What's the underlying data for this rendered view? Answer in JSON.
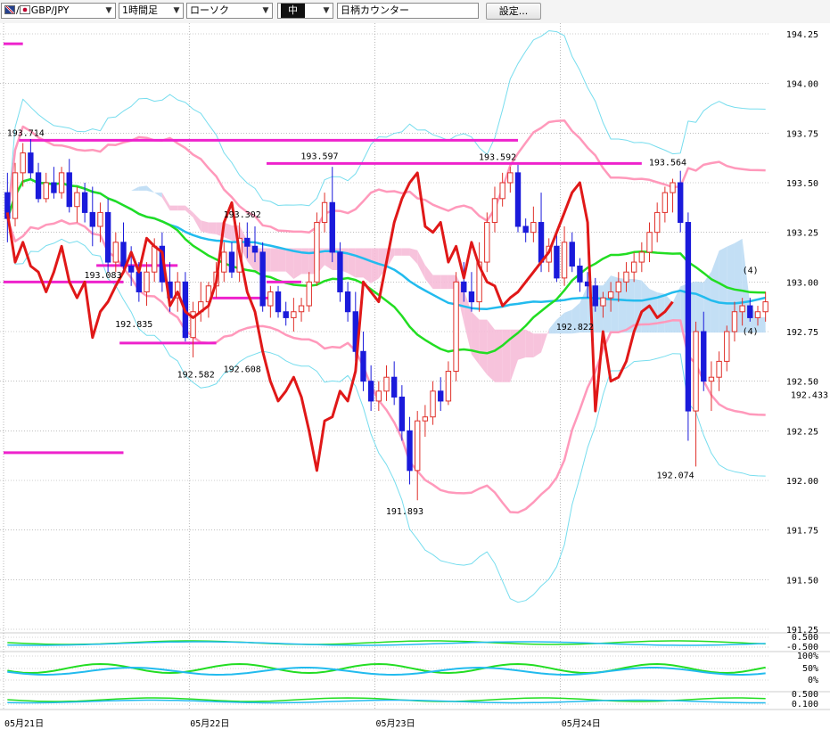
{
  "toolbar": {
    "symbol": "GBP/JPY",
    "timeframe": "1時間足",
    "chart_style": "ローソク",
    "size": "中",
    "counter": "日柄カウンター",
    "settings": "設定..."
  },
  "colors": {
    "up_candle": "#e0302a",
    "down_candle": "#1a1adb",
    "sma_short": "#22dd22",
    "sma_long": "#22bbee",
    "bb_2sigma": "#ff99bb",
    "bb_3sigma": "#77ddee",
    "red_line": "#e01818",
    "level_lines": "#ee22cc",
    "kumo_bear": "#f6bcd8",
    "kumo_bull": "#bcdcf4"
  },
  "chart_data": {
    "type": "candlestick",
    "pair": "GBP/JPY",
    "y_axis": {
      "min": 191.25,
      "max": 194.25,
      "ticks": [
        "194.25",
        "194.00",
        "193.75",
        "193.50",
        "193.25",
        "193.00",
        "192.75",
        "192.50",
        "192.25",
        "192.00",
        "191.75",
        "191.50",
        "191.25"
      ]
    },
    "current_price": "192.433",
    "x_labels": [
      "05月21日",
      "05月22日",
      "05月23日",
      "05月24日"
    ],
    "annotations": [
      {
        "text": "193.714",
        "price": 193.714
      },
      {
        "text": "193.083",
        "price": 193.083
      },
      {
        "text": "192.835",
        "price": 192.835
      },
      {
        "text": "192.582",
        "price": 192.582
      },
      {
        "text": "193.302",
        "price": 193.302
      },
      {
        "text": "192.608",
        "price": 192.608
      },
      {
        "text": "193.597",
        "price": 193.597
      },
      {
        "text": "191.893",
        "price": 191.893
      },
      {
        "text": "193.592",
        "price": 193.592
      },
      {
        "text": "192.822",
        "price": 192.822
      },
      {
        "text": "193.564",
        "price": 193.564
      },
      {
        "text": "192.074",
        "price": 192.074
      },
      {
        "text": "(4)",
        "price": 193.0
      },
      {
        "text": "(4)",
        "price": 192.8
      }
    ],
    "candles": [
      [
        193.45,
        193.55,
        193.2,
        193.32
      ],
      [
        193.32,
        193.6,
        193.28,
        193.55
      ],
      [
        193.55,
        193.7,
        193.48,
        193.65
      ],
      [
        193.65,
        193.72,
        193.52,
        193.55
      ],
      [
        193.55,
        193.6,
        193.4,
        193.42
      ],
      [
        193.42,
        193.55,
        193.4,
        193.5
      ],
      [
        193.5,
        193.58,
        193.42,
        193.45
      ],
      [
        193.45,
        193.58,
        193.42,
        193.55
      ],
      [
        193.55,
        193.62,
        193.35,
        193.38
      ],
      [
        193.38,
        193.48,
        193.3,
        193.45
      ],
      [
        193.45,
        193.5,
        193.3,
        193.35
      ],
      [
        193.35,
        193.48,
        193.18,
        193.28
      ],
      [
        193.28,
        193.4,
        193.2,
        193.35
      ],
      [
        193.35,
        193.42,
        193.05,
        193.1
      ],
      [
        193.1,
        193.25,
        193.05,
        193.2
      ],
      [
        193.2,
        193.3,
        193.05,
        193.08
      ],
      [
        193.08,
        193.18,
        192.98,
        193.05
      ],
      [
        193.05,
        193.1,
        192.9,
        192.95
      ],
      [
        192.95,
        193.1,
        192.88,
        193.05
      ],
      [
        193.05,
        193.22,
        193.0,
        193.18
      ],
      [
        193.18,
        193.25,
        192.95,
        193.0
      ],
      [
        193.0,
        193.1,
        192.85,
        192.92
      ],
      [
        192.92,
        193.05,
        192.85,
        193.0
      ],
      [
        193.0,
        193.05,
        192.7,
        192.72
      ],
      [
        192.72,
        192.9,
        192.62,
        192.85
      ],
      [
        192.85,
        193.0,
        192.8,
        192.9
      ],
      [
        192.9,
        193.0,
        192.82,
        192.98
      ],
      [
        192.98,
        193.1,
        192.92,
        193.05
      ],
      [
        193.05,
        193.2,
        193.0,
        193.15
      ],
      [
        193.15,
        193.2,
        193.02,
        193.05
      ],
      [
        193.05,
        193.3,
        193.0,
        193.22
      ],
      [
        193.22,
        193.3,
        193.12,
        193.18
      ],
      [
        193.18,
        193.28,
        193.1,
        193.15
      ],
      [
        193.15,
        193.2,
        192.85,
        192.88
      ],
      [
        192.88,
        192.98,
        192.82,
        192.95
      ],
      [
        192.95,
        192.98,
        192.82,
        192.85
      ],
      [
        192.85,
        192.9,
        192.78,
        192.82
      ],
      [
        192.82,
        192.92,
        192.75,
        192.85
      ],
      [
        192.85,
        192.92,
        192.8,
        192.88
      ],
      [
        192.88,
        193.05,
        192.85,
        193.0
      ],
      [
        193.0,
        193.35,
        192.98,
        193.3
      ],
      [
        193.3,
        193.45,
        193.25,
        193.4
      ],
      [
        193.4,
        193.58,
        193.1,
        193.15
      ],
      [
        193.15,
        193.2,
        192.9,
        192.95
      ],
      [
        192.95,
        193.0,
        192.8,
        192.85
      ],
      [
        192.85,
        192.95,
        192.6,
        192.65
      ],
      [
        192.65,
        192.75,
        192.45,
        192.5
      ],
      [
        192.5,
        192.58,
        192.35,
        192.4
      ],
      [
        192.4,
        192.5,
        192.35,
        192.45
      ],
      [
        192.45,
        192.58,
        192.4,
        192.52
      ],
      [
        192.52,
        192.6,
        192.38,
        192.42
      ],
      [
        192.42,
        192.48,
        192.2,
        192.25
      ],
      [
        192.25,
        192.32,
        191.98,
        192.05
      ],
      [
        192.05,
        192.35,
        191.9,
        192.3
      ],
      [
        192.3,
        192.38,
        192.22,
        192.32
      ],
      [
        192.32,
        192.5,
        192.28,
        192.45
      ],
      [
        192.45,
        192.52,
        192.35,
        192.4
      ],
      [
        192.4,
        192.6,
        192.38,
        192.55
      ],
      [
        192.55,
        193.05,
        192.5,
        193.0
      ],
      [
        193.0,
        193.1,
        192.9,
        192.95
      ],
      [
        192.95,
        193.05,
        192.85,
        192.9
      ],
      [
        192.9,
        193.2,
        192.85,
        193.1
      ],
      [
        193.1,
        193.35,
        193.05,
        193.3
      ],
      [
        193.3,
        193.48,
        193.25,
        193.42
      ],
      [
        193.42,
        193.55,
        193.38,
        193.5
      ],
      [
        193.5,
        193.58,
        193.45,
        193.55
      ],
      [
        193.55,
        193.59,
        193.25,
        193.28
      ],
      [
        193.28,
        193.32,
        193.2,
        193.25
      ],
      [
        193.25,
        193.38,
        193.2,
        193.3
      ],
      [
        193.3,
        193.45,
        193.05,
        193.1
      ],
      [
        193.1,
        193.22,
        193.05,
        193.18
      ],
      [
        193.18,
        193.25,
        193.0,
        193.02
      ],
      [
        193.02,
        193.28,
        192.98,
        193.2
      ],
      [
        193.2,
        193.25,
        193.05,
        193.08
      ],
      [
        193.08,
        193.12,
        192.95,
        193.0
      ],
      [
        193.0,
        193.05,
        192.92,
        192.98
      ],
      [
        192.98,
        193.02,
        192.85,
        192.88
      ],
      [
        192.88,
        192.95,
        192.82,
        192.92
      ],
      [
        192.92,
        193.0,
        192.85,
        192.95
      ],
      [
        192.95,
        193.05,
        192.9,
        193.0
      ],
      [
        193.0,
        193.1,
        192.95,
        193.05
      ],
      [
        193.05,
        193.15,
        193.0,
        193.1
      ],
      [
        193.1,
        193.2,
        193.05,
        193.15
      ],
      [
        193.15,
        193.3,
        193.1,
        193.25
      ],
      [
        193.25,
        193.4,
        193.2,
        193.35
      ],
      [
        193.35,
        193.48,
        193.3,
        193.45
      ],
      [
        193.45,
        193.52,
        193.35,
        193.5
      ],
      [
        193.5,
        193.56,
        193.25,
        193.3
      ],
      [
        193.3,
        193.35,
        192.2,
        192.35
      ],
      [
        192.35,
        192.8,
        192.07,
        192.75
      ],
      [
        192.75,
        192.85,
        192.45,
        192.5
      ],
      [
        192.5,
        192.6,
        192.35,
        192.52
      ],
      [
        192.52,
        192.65,
        192.45,
        192.6
      ],
      [
        192.6,
        192.78,
        192.55,
        192.75
      ],
      [
        192.75,
        192.9,
        192.7,
        192.85
      ],
      [
        192.85,
        192.92,
        192.78,
        192.88
      ],
      [
        192.88,
        192.92,
        192.8,
        192.82
      ],
      [
        192.82,
        192.88,
        192.78,
        192.85
      ],
      [
        192.85,
        192.95,
        192.8,
        192.9
      ]
    ],
    "indicators": [
      "sma_short",
      "sma_long",
      "bollinger_2sigma",
      "bollinger_3sigma",
      "ichimoku_kumo",
      "ichimoku_chikou"
    ],
    "sub_panels": [
      {
        "ticks": [
          "0.500",
          "-0.500"
        ]
      },
      {
        "ticks": [
          "100%",
          "50%",
          "0%"
        ]
      },
      {
        "ticks": [
          "0.500",
          "0.100"
        ]
      }
    ],
    "grid": true
  }
}
